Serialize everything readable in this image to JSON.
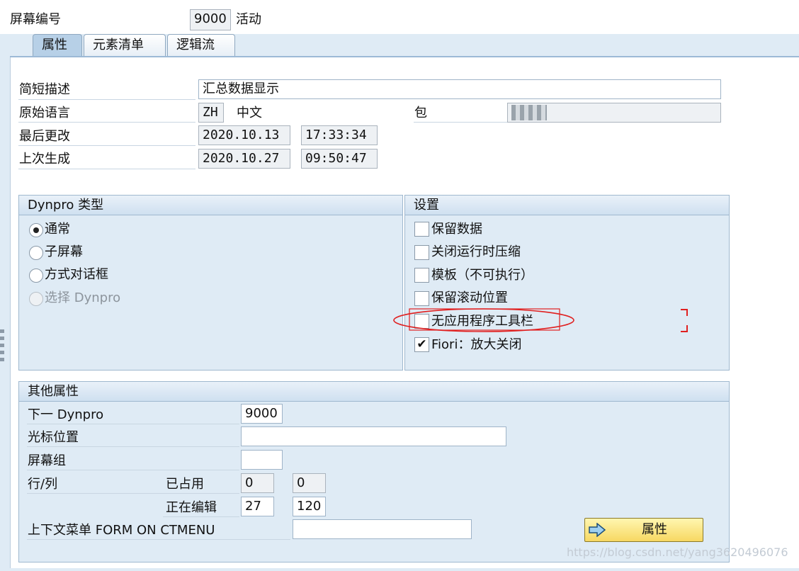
{
  "header": {
    "screen_no_label": "屏幕编号",
    "screen_no": "9000",
    "status": "活动"
  },
  "tabs": [
    {
      "label": "属性",
      "active": true
    },
    {
      "label": "元素清单",
      "active": false
    },
    {
      "label": "逻辑流",
      "active": false
    }
  ],
  "attributes": {
    "short_desc_label": "简短描述",
    "short_desc": "汇总数据显示",
    "orig_lang_label": "原始语言",
    "orig_lang_code": "ZH",
    "orig_lang_name": "中文",
    "package_label": "包",
    "package_value": "",
    "last_changed_label": "最后更改",
    "last_changed_date": "2020.10.13",
    "last_changed_time": "17:33:34",
    "last_generated_label": "上次生成",
    "last_generated_date": "2020.10.27",
    "last_generated_time": "09:50:47"
  },
  "dynpro_type": {
    "title": "Dynpro 类型",
    "options": [
      {
        "label": "通常",
        "selected": true,
        "disabled": false
      },
      {
        "label": "子屏幕",
        "selected": false,
        "disabled": false
      },
      {
        "label": "方式对话框",
        "selected": false,
        "disabled": false
      },
      {
        "label": "选择 Dynpro",
        "selected": false,
        "disabled": true
      }
    ]
  },
  "settings": {
    "title": "设置",
    "options": [
      {
        "label": "保留数据",
        "checked": false
      },
      {
        "label": "关闭运行时压缩",
        "checked": false
      },
      {
        "label": "模板（不可执行）",
        "checked": false
      },
      {
        "label": "保留滚动位置",
        "checked": false
      },
      {
        "label": "无应用程序工具栏",
        "checked": false
      },
      {
        "label": "Fiori：放大关闭",
        "checked": true
      }
    ]
  },
  "other": {
    "title": "其他属性",
    "next_dynpro_label": "下一 Dynpro",
    "next_dynpro": "9000",
    "cursor_label": "光标位置",
    "cursor_value": "",
    "screen_group_label": "屏幕组",
    "screen_group_value": "",
    "rowcol_label": "行/列",
    "occupied_label": "已占用",
    "occupied_row": "0",
    "occupied_col": "0",
    "editing_label": "正在编辑",
    "editing_row": "27",
    "editing_col": "120",
    "context_menu_label": "上下文菜单 FORM ON CTMENU",
    "context_menu_value": "",
    "attr_button_label": "属性"
  },
  "watermark": "https://blog.csdn.net/yang3620496076",
  "colors": {
    "background": "#dfebf5",
    "annotation": "#e02020",
    "button_accent": "#f7d862"
  }
}
